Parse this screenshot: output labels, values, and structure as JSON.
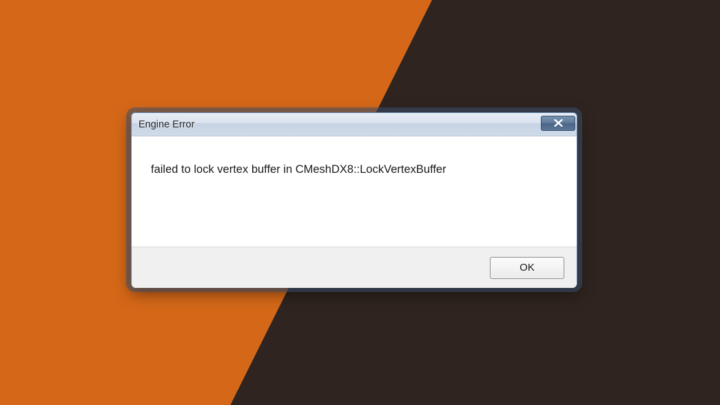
{
  "dialog": {
    "title": "Engine Error",
    "message": "failed to lock vertex buffer in CMeshDX8::LockVertexBuffer",
    "ok_label": "OK"
  }
}
